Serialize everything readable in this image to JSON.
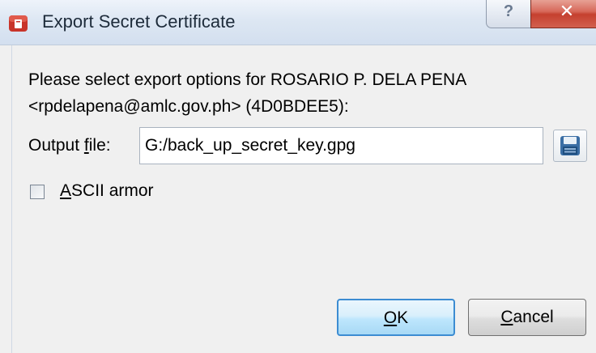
{
  "window": {
    "title": "Export Secret Certificate",
    "help_glyph": "?",
    "close_glyph": "✕"
  },
  "dialog": {
    "intro_line1": "Please select export options for ROSARIO P. DELA PENA",
    "intro_line2": "<rpdelapena@amlc.gov.ph> (4D0BDEE5):",
    "output_label": "Output file:",
    "output_value": "G:/back_up_secret_key.gpg",
    "ascii_armor_label": "ASCII armor",
    "ascii_armor_checked": false,
    "ok_label": "OK",
    "cancel_label": "Cancel"
  },
  "icons": {
    "app": "kleopatra-app-icon",
    "save": "save-disk-icon"
  }
}
